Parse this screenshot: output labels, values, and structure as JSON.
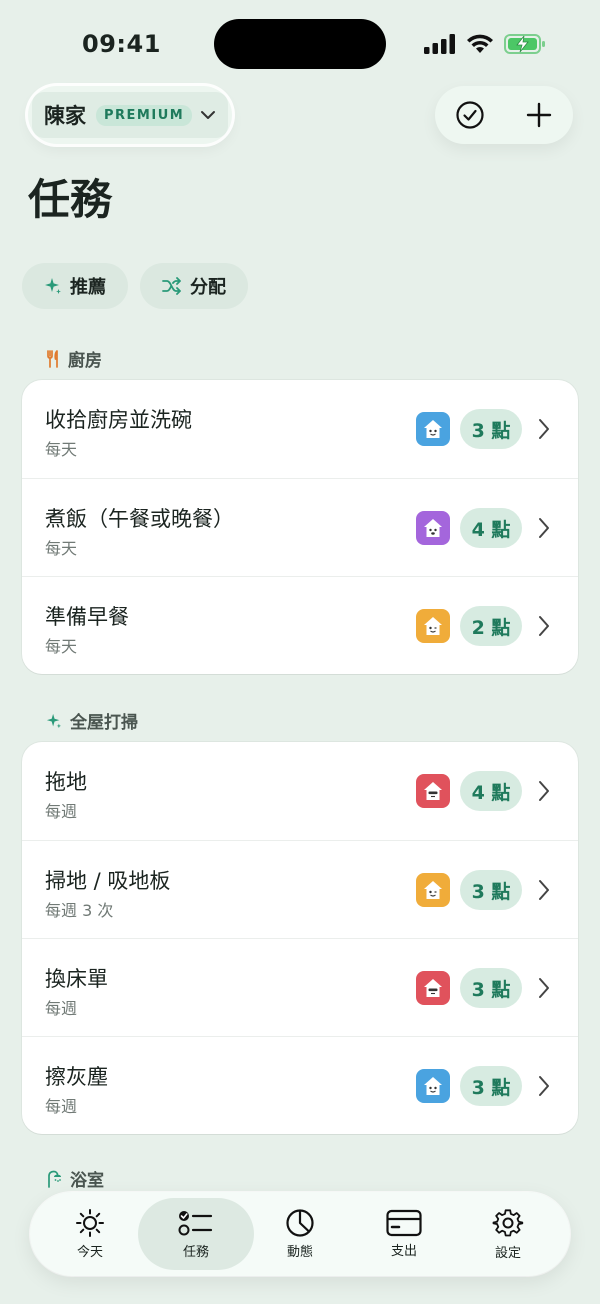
{
  "status_bar": {
    "time": "09:41"
  },
  "header": {
    "household_name": "陳家",
    "premium_label": "PREMIUM"
  },
  "page": {
    "title": "任務"
  },
  "filters": [
    {
      "label": "推薦",
      "icon": "sparkle-icon"
    },
    {
      "label": "分配",
      "icon": "shuffle-icon"
    }
  ],
  "sections": [
    {
      "title": "廚房",
      "icon": "fork-knife-icon",
      "tasks": [
        {
          "title": "收拾廚房並洗碗",
          "frequency": "每天",
          "points": "3 點",
          "avatar_color": "#4aa3e0"
        },
        {
          "title": "煮飯（午餐或晚餐）",
          "frequency": "每天",
          "points": "4 點",
          "avatar_color": "#a466dc"
        },
        {
          "title": "準備早餐",
          "frequency": "每天",
          "points": "2 點",
          "avatar_color": "#f0ac3a"
        }
      ]
    },
    {
      "title": "全屋打掃",
      "icon": "sparkle-icon",
      "tasks": [
        {
          "title": "拖地",
          "frequency": "每週",
          "points": "4 點",
          "avatar_color": "#e0525c"
        },
        {
          "title": "掃地 / 吸地板",
          "frequency": "每週 3 次",
          "points": "3 點",
          "avatar_color": "#f0ac3a"
        },
        {
          "title": "換床單",
          "frequency": "每週",
          "points": "3 點",
          "avatar_color": "#e0525c"
        },
        {
          "title": "擦灰塵",
          "frequency": "每週",
          "points": "3 點",
          "avatar_color": "#4aa3e0"
        }
      ]
    },
    {
      "title": "浴室",
      "icon": "shower-icon",
      "tasks": []
    }
  ],
  "tab_bar": {
    "active": "任務",
    "tabs": [
      {
        "label": "今天",
        "icon": "sun-icon"
      },
      {
        "label": "任務",
        "icon": "task-list-icon"
      },
      {
        "label": "動態",
        "icon": "pie-chart-icon"
      },
      {
        "label": "支出",
        "icon": "credit-card-icon"
      },
      {
        "label": "設定",
        "icon": "gear-icon"
      }
    ]
  },
  "colors": {
    "accent": "#1f7a5c",
    "background": "#e7f0ea"
  }
}
